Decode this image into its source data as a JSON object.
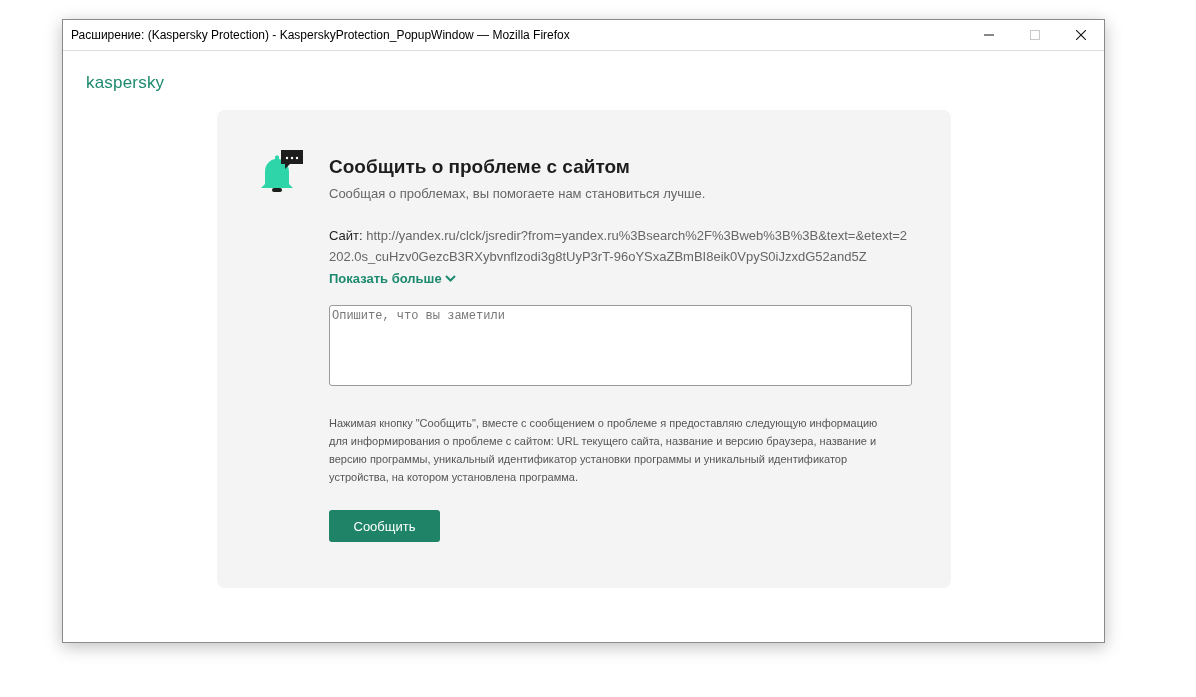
{
  "window": {
    "title": "Расширение: (Kaspersky Protection) - KasperskyProtection_PopupWindow — Mozilla Firefox",
    "controls": [
      {
        "kind": "minimize",
        "disabled": false
      },
      {
        "kind": "maximize",
        "disabled": true
      },
      {
        "kind": "close",
        "disabled": false
      }
    ]
  },
  "logo": {
    "text": "kaspersky"
  },
  "report": {
    "title": "Сообщить о проблеме с сайтом",
    "subtitle": "Сообщая о проблемах, вы помогаете нам становиться лучше.",
    "site_label": "Сайт:",
    "site_url": "http://yandex.ru/clck/jsredir?from=yandex.ru%3Bsearch%2F%3Bweb%3B%3B&text=&etext=2202.0s_cuHzv0GezcB3RXybvnflzodi3g8tUyP3rT-96oYSxaZBmBI8eik0VpyS0iJzxdG52and5Z",
    "show_more": "Показать больше",
    "description": {
      "placeholder": "Опишите, что вы заметили"
    },
    "notice": "Нажимая кнопку \"Сообщить\", вместе с сообщением о проблеме я предоставляю следующую информацию для информирования о проблеме с сайтом: URL текущего сайта, название и версию браузера, название и версию программы, уникальный идентификатор установки программы и уникальный идентификатор устройства, на котором установлена программа.",
    "submit": "Сообщить"
  }
}
